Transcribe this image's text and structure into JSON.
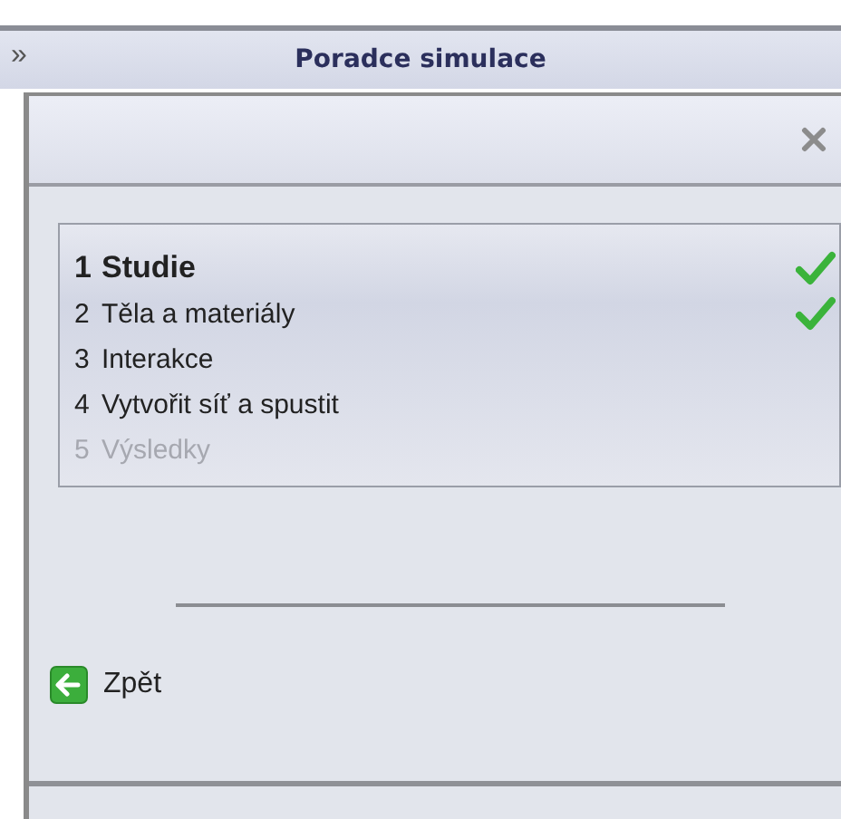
{
  "window": {
    "collapse_glyph": "»",
    "title": "Poradce simulace"
  },
  "steps": [
    {
      "number": "1",
      "label": "Studie",
      "selected": true,
      "completed": true,
      "disabled": false
    },
    {
      "number": "2",
      "label": "Těla a materiály",
      "selected": false,
      "completed": true,
      "disabled": false
    },
    {
      "number": "3",
      "label": "Interakce",
      "selected": false,
      "completed": false,
      "disabled": false
    },
    {
      "number": "4",
      "label": "Vytvořit síť a spustit",
      "selected": false,
      "completed": false,
      "disabled": false
    },
    {
      "number": "5",
      "label": "Výsledky",
      "selected": false,
      "completed": false,
      "disabled": true
    }
  ],
  "back_button": {
    "label": "Zpět"
  }
}
